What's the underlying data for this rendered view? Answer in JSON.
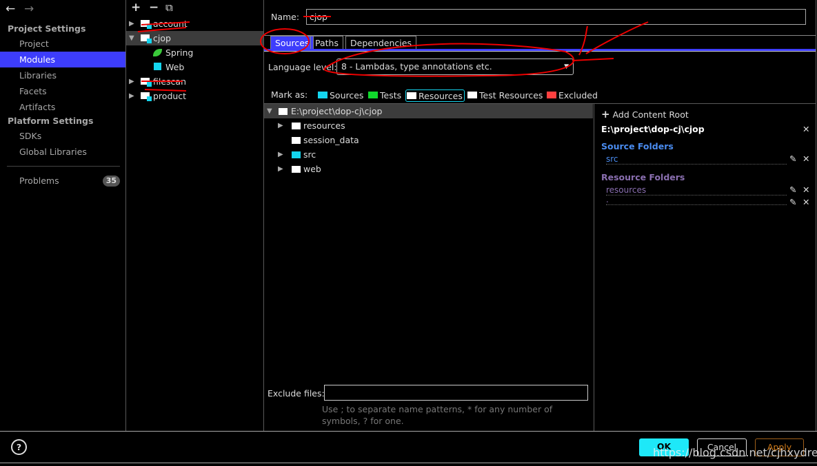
{
  "nav": {
    "back": "←",
    "forward": "→"
  },
  "sidebar": {
    "project_settings": "Project Settings",
    "items": [
      {
        "label": "Project"
      },
      {
        "label": "Modules"
      },
      {
        "label": "Libraries"
      },
      {
        "label": "Facets"
      },
      {
        "label": "Artifacts"
      }
    ],
    "platform_settings": "Platform Settings",
    "platform_items": [
      {
        "label": "SDKs"
      },
      {
        "label": "Global Libraries"
      }
    ],
    "problems": {
      "label": "Problems",
      "count": "35"
    }
  },
  "module_toolbar": {
    "add": "+",
    "remove": "−",
    "copy": "⧉"
  },
  "modules": [
    {
      "label": "account"
    },
    {
      "label": "cjop"
    },
    {
      "label": "Spring"
    },
    {
      "label": "Web"
    },
    {
      "label": "filescan"
    },
    {
      "label": "product"
    }
  ],
  "name_field": {
    "label": "Name:",
    "value": "cjop"
  },
  "tabs": [
    {
      "label": "Sources"
    },
    {
      "label": "Paths"
    },
    {
      "label": "Dependencies"
    }
  ],
  "language_level": {
    "label": "Language level:",
    "value": "8 - Lambdas, type annotations etc."
  },
  "mark_as": {
    "label": "Mark as:",
    "items": [
      {
        "label": "Sources",
        "color": "#14d6f0"
      },
      {
        "label": "Tests",
        "color": "#10d92c"
      },
      {
        "label": "Resources",
        "color": "#ffffff"
      },
      {
        "label": "Test Resources",
        "color": "#ffffff"
      },
      {
        "label": "Excluded",
        "color": "#ff4040"
      }
    ]
  },
  "file_tree": {
    "root": "E:\\project\\dop-cj\\cjop",
    "children": [
      {
        "label": "resources"
      },
      {
        "label": "session_data"
      },
      {
        "label": "src"
      },
      {
        "label": "web"
      }
    ]
  },
  "exclude": {
    "label": "Exclude files:",
    "value": "",
    "hint": "Use ; to separate name patterns, * for any number of symbols, ? for one."
  },
  "content_root": {
    "add_label": "Add Content Root",
    "path": "E:\\project\\dop-cj\\cjop",
    "source_title": "Source Folders",
    "source_folders": [
      "src"
    ],
    "resource_title": "Resource Folders",
    "resource_folders": [
      "resources",
      "."
    ],
    "source_color": "#4a8cf0",
    "resource_color": "#8a6fb0"
  },
  "footer": {
    "help": "?",
    "ok": "OK",
    "cancel": "Cancel",
    "apply": "Apply",
    "watermark": "https://blog.csdn.net/cjhxydream"
  }
}
